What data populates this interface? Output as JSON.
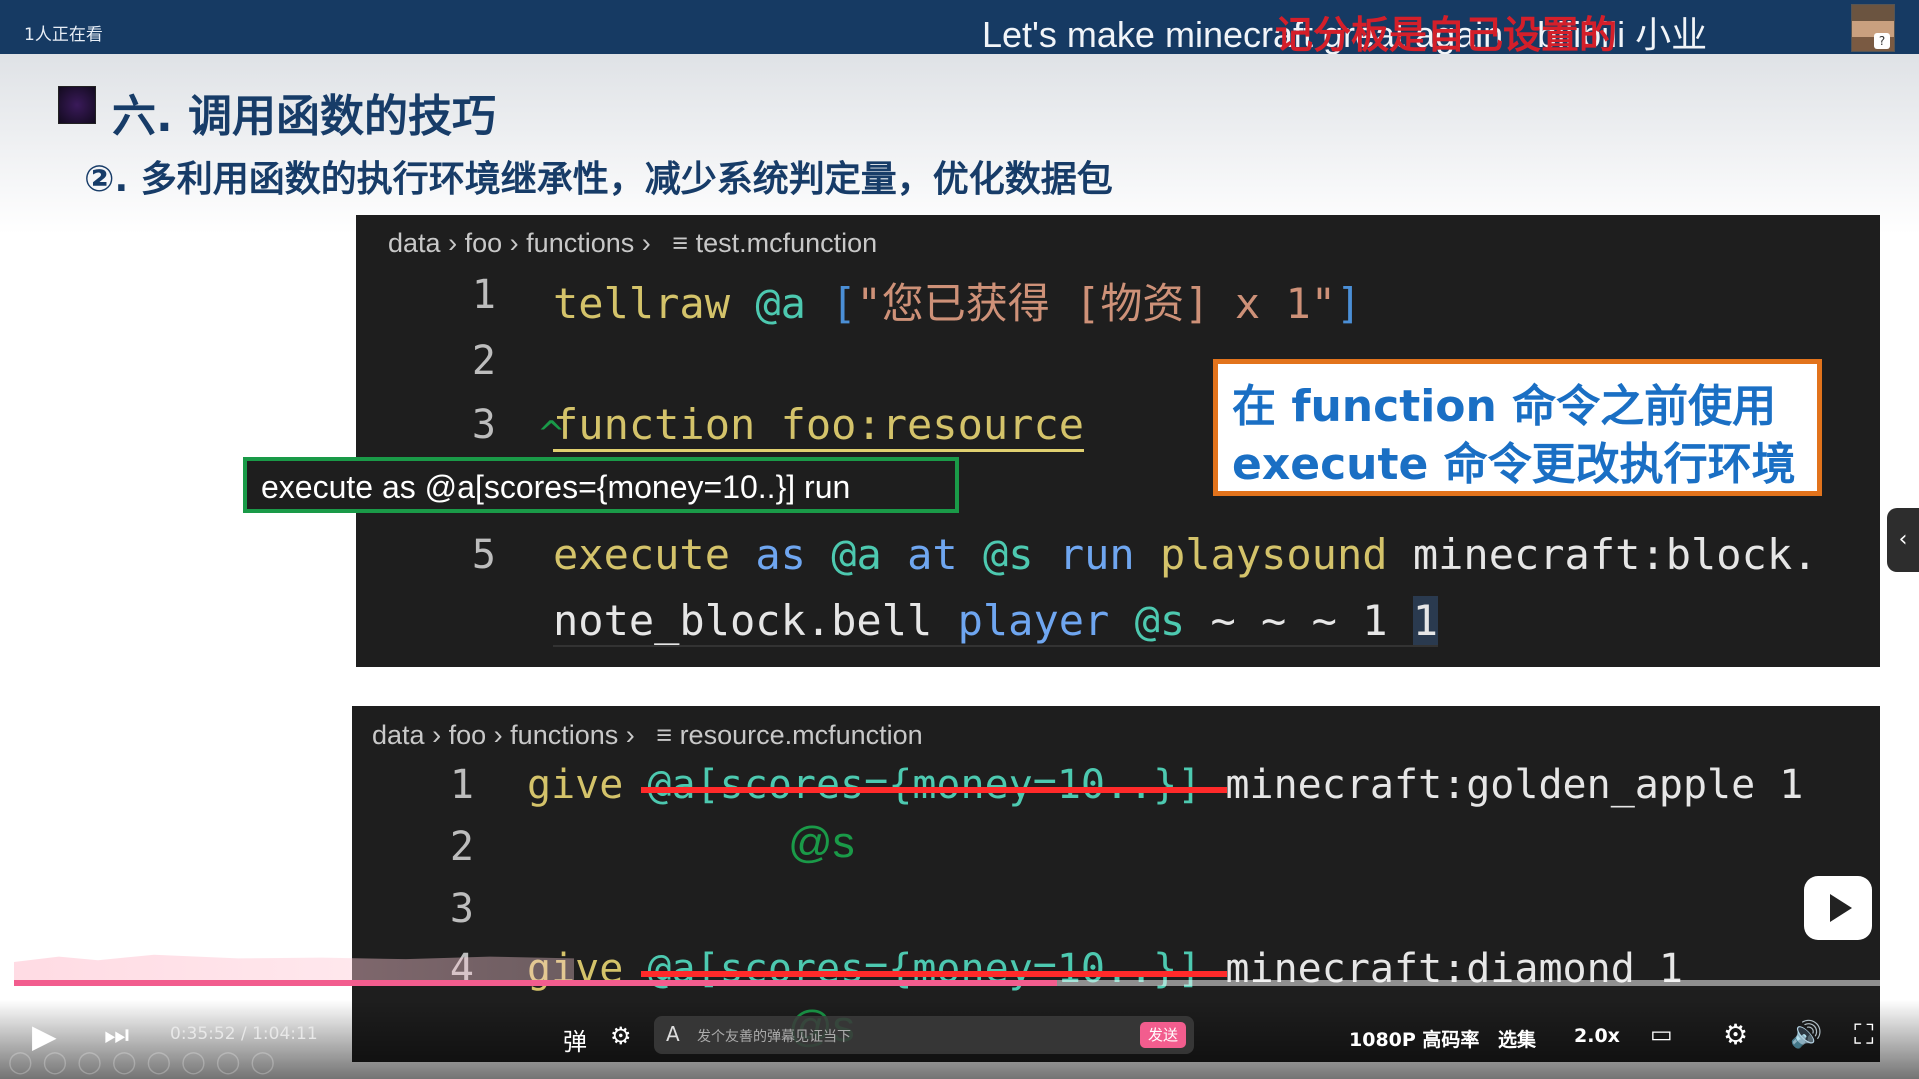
{
  "top_bar": {
    "viewers": "1人正在看",
    "video_title": "Let's make minecraft great again",
    "danmaku_overlay": "记分板是自己设置的",
    "brand": "bilibili 小业"
  },
  "slide": {
    "heading": "六. 调用函数的技巧",
    "subheading": "②. 多利用函数的执行环境继承性，减少系统判定量，优化数据包"
  },
  "panel1": {
    "breadcrumb": [
      "data",
      "foo",
      "functions",
      "test.mcfunction"
    ],
    "lines": [
      {
        "n": "1",
        "tellraw": "tellraw",
        "sel": "@a",
        "open": "[",
        "str": "\"您已获得 [物资] x 1\"",
        "close": "]"
      },
      {
        "n": "2"
      },
      {
        "n": "3",
        "kw": "function",
        "rest": "foo:resource"
      },
      {
        "n": "5",
        "execute": "execute",
        "as": "as",
        "sel1": "@a",
        "at": "at",
        "sel2": "@s",
        "run": "run",
        "cmd": "playsound",
        "arg": "minecraft:block.",
        "cont": "note_block.bell",
        "player": "player",
        "sel3": "@s",
        "tail": "~ ~ ~ 1",
        "last": "1"
      }
    ]
  },
  "annotations": {
    "green_box": "execute as @a[scores={money=10..}] run",
    "orange_line1": "在 function 命令之前使用",
    "orange_line2": "execute 命令更改执行环境",
    "caret": "^",
    "at_s_1": "@s",
    "at_s_2": "@s"
  },
  "panel2": {
    "breadcrumb": [
      "data",
      "foo",
      "functions",
      "resource.mcfunction"
    ],
    "lines": [
      {
        "n": "1",
        "cmd": "give",
        "sel": "@a[scores={money=10..}]",
        "item": "minecraft:golden_apple 1"
      },
      {
        "n": "2"
      },
      {
        "n": "3"
      },
      {
        "n": "4",
        "cmd": "give",
        "sel": "@a[scores={money=10..}]",
        "item": "minecraft:diamond 1"
      }
    ]
  },
  "player": {
    "time_current": "0:35:52",
    "time_sep": "/",
    "time_total": "1:04:11",
    "progress_fraction": 0.559,
    "danmaku_placeholder": "发个友善的弹幕见证当下",
    "danmaku_send": "发送",
    "danmaku_input_icon": "A",
    "quality": "1080P 高码率",
    "episodes": "选集",
    "speed": "2.0x",
    "accent_color": "#f25d8e"
  },
  "icons": {
    "play": "▶",
    "next": "⏭",
    "danmaku_toggle": "弹",
    "danmaku_setting": "⚙",
    "gear": "⚙",
    "volume": "🔊",
    "fullscreen": "⛶",
    "side_handle": "‹",
    "breadcrumb_sep": "›",
    "file": "≡"
  }
}
